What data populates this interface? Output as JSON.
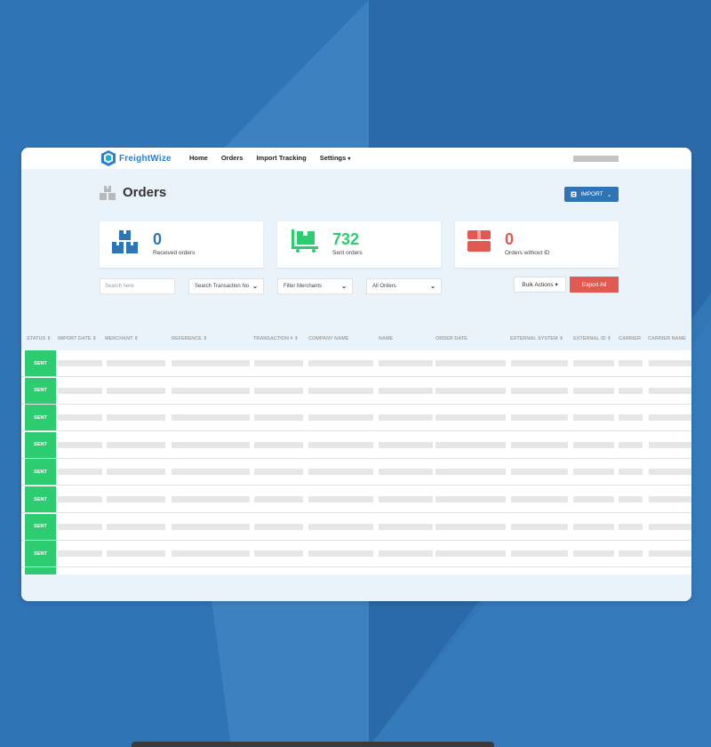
{
  "brand": {
    "name": "FreightWize"
  },
  "nav": {
    "links": [
      "Home",
      "Orders",
      "Import Tracking",
      "Settings"
    ],
    "settings_caret": "▾"
  },
  "page": {
    "title": "Orders"
  },
  "import_button": {
    "label": "IMPORT",
    "chevron": "⌄"
  },
  "stats": [
    {
      "value": "0",
      "label": "Received orders",
      "color": "#2f74b5",
      "icon": "boxes-icon"
    },
    {
      "value": "732",
      "label": "Sent orders",
      "color": "#2ecc71",
      "icon": "cart-icon"
    },
    {
      "value": "0",
      "label": "Orders without ID",
      "color": "#e05a52",
      "icon": "box-icon"
    }
  ],
  "filters": {
    "search_placeholder": "Search here",
    "transaction_select": "Search Transaction No",
    "merchant_select": "Filter Merchants",
    "orders_select": "All Orders",
    "select_chevron": "⌄"
  },
  "actions": {
    "bulk": "Bulk Actions ▾",
    "export": "Export All"
  },
  "table": {
    "columns": [
      "STATUS ⇕",
      "IMPORT DATE ⇕",
      "MERCHANT ⇕",
      "REFERENCE ⇕",
      "TRANSACTION # ⇕",
      "COMPANY NAME",
      "NAME",
      "ORDER DATE",
      "EXTERNAL SYSTEM ⇕",
      "EXTERNAL ID ⇕",
      "CARRIER",
      "CARRIER NAME"
    ],
    "rows": [
      "SENT",
      "SENT",
      "SENT",
      "SENT",
      "SENT",
      "SENT",
      "SENT",
      "SENT"
    ]
  },
  "colors": {
    "background": "#2f74b5",
    "accent": "#2f74b5",
    "success": "#2ecc71",
    "danger": "#e05a52"
  }
}
